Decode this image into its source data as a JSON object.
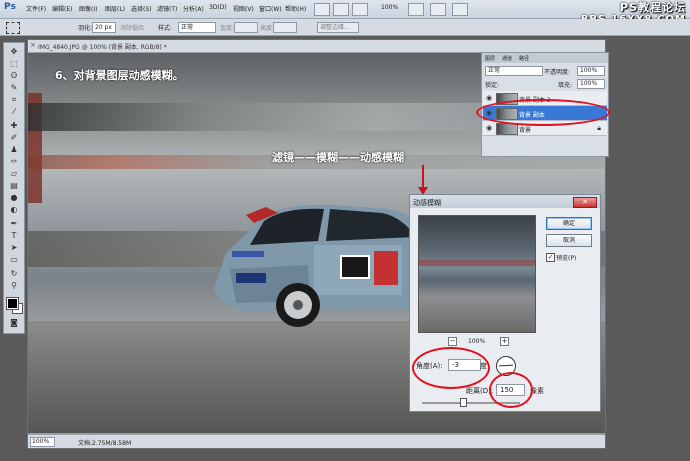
{
  "app": {
    "logo": "Ps",
    "menus": [
      "文件(F)",
      "编辑(E)",
      "图像(I)",
      "图层(L)",
      "选择(S)",
      "滤镜(T)",
      "分析(A)",
      "3D(D)",
      "视图(V)",
      "窗口(W)",
      "帮助(H)"
    ],
    "zoom_readout": "100%",
    "watermark_line1": "PS教程论坛",
    "watermark_line2": "BBS.16XX8.COM"
  },
  "options_bar": {
    "feather_label": "羽化:",
    "feather_value": "20 px",
    "antialias_label": "消除锯齿",
    "style_label": "样式:",
    "style_value": "正常",
    "width_label": "宽度:",
    "height_label": "高度:",
    "refine_edge_button": "调整边缘..."
  },
  "document": {
    "tab_title": "IMG_4840.JPG @ 100% (背景 副本, RGB/8) *",
    "step_caption": "6、对背景图层动感模糊。",
    "path_caption": "滤镜——模糊——动感模糊",
    "status_zoom": "100%",
    "status_doc": "文档:2.75M/8.58M"
  },
  "layers_panel": {
    "tabs": [
      "图层",
      "通道",
      "路径"
    ],
    "blend_mode": "正常",
    "opacity_label": "不透明度:",
    "opacity_value": "100%",
    "lock_label": "锁定:",
    "fill_label": "填充:",
    "fill_value": "100%",
    "layers": [
      {
        "name": "背景 副本 2"
      },
      {
        "name": "背景 副本"
      },
      {
        "name": "背景"
      }
    ]
  },
  "motion_blur_dialog": {
    "title": "动感模糊",
    "ok_label": "确定",
    "cancel_label": "取消",
    "preview_label": "预览(P)",
    "preview_checked": true,
    "preview_zoom": "100%",
    "angle_label": "角度(A):",
    "angle_value": "-3",
    "angle_unit": "度",
    "distance_label": "距离(D):",
    "distance_value": "150",
    "distance_unit": "像素"
  },
  "colors": {
    "highlight_ellipse": "#e1121f",
    "selected_layer": "#3a78d8"
  }
}
